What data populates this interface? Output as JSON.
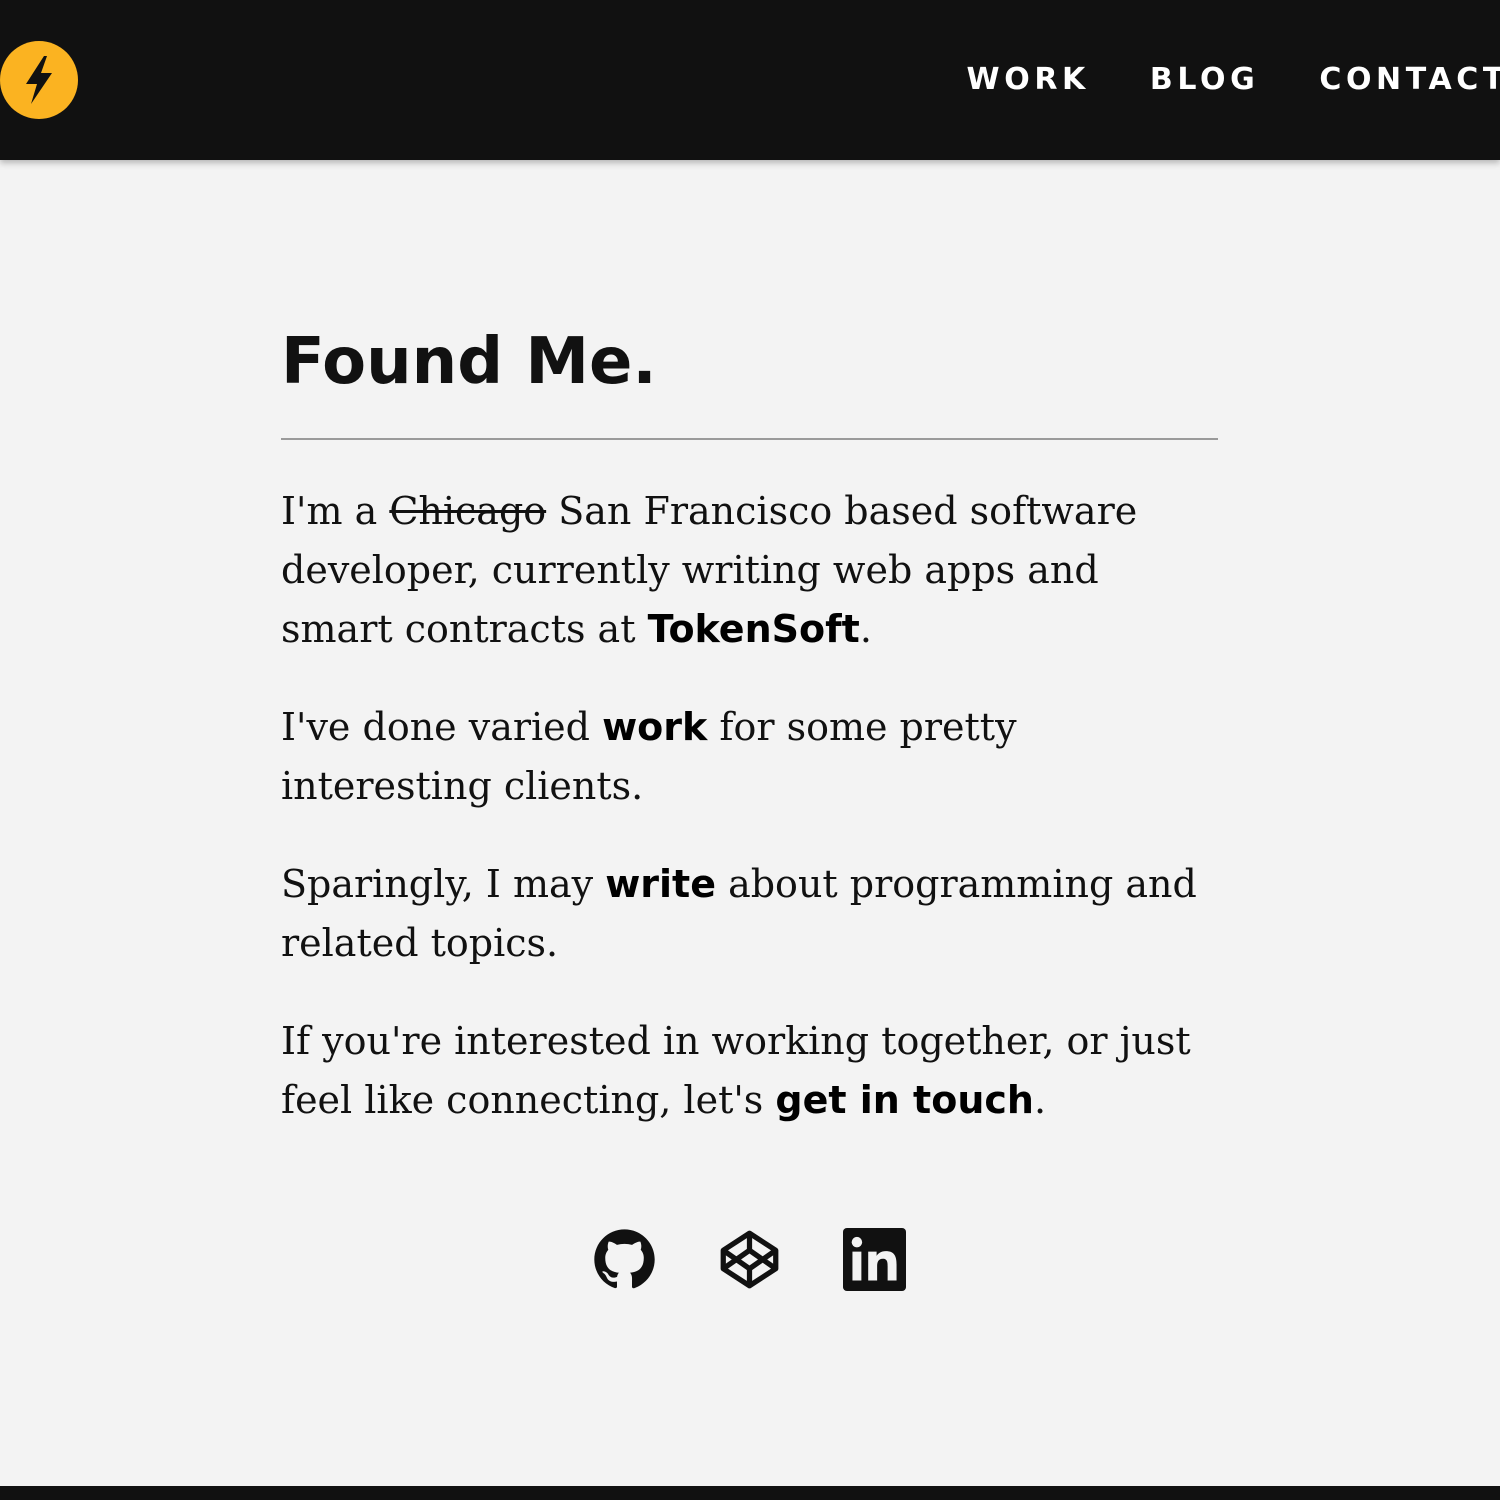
{
  "header": {
    "logo_icon": "lightning-bolt-icon",
    "accent_color": "#fbb321",
    "nav": [
      {
        "label": "WORK"
      },
      {
        "label": "BLOG"
      },
      {
        "label": "CONTACT"
      }
    ]
  },
  "main": {
    "title": "Found Me.",
    "paragraphs": {
      "p1": {
        "before": "I'm a ",
        "struck": "Chicago",
        "middle": " San Francisco based software developer, currently writing web apps and smart contracts at ",
        "link": "TokenSoft",
        "after": "."
      },
      "p2": {
        "before": "I've done varied ",
        "link": "work",
        "after": " for some pretty interesting clients."
      },
      "p3": {
        "before": "Sparingly, I may ",
        "link": "write",
        "after": " about programming and related topics."
      },
      "p4": {
        "before": "If you're interested in working together, or just feel like connecting, let's ",
        "link": "get in touch",
        "after": "."
      }
    }
  },
  "socials": [
    {
      "icon": "github-icon"
    },
    {
      "icon": "codepen-icon"
    },
    {
      "icon": "linkedin-icon"
    }
  ],
  "colors": {
    "header_bg": "#111111",
    "page_bg": "#f3f3f3",
    "text": "#111111"
  }
}
